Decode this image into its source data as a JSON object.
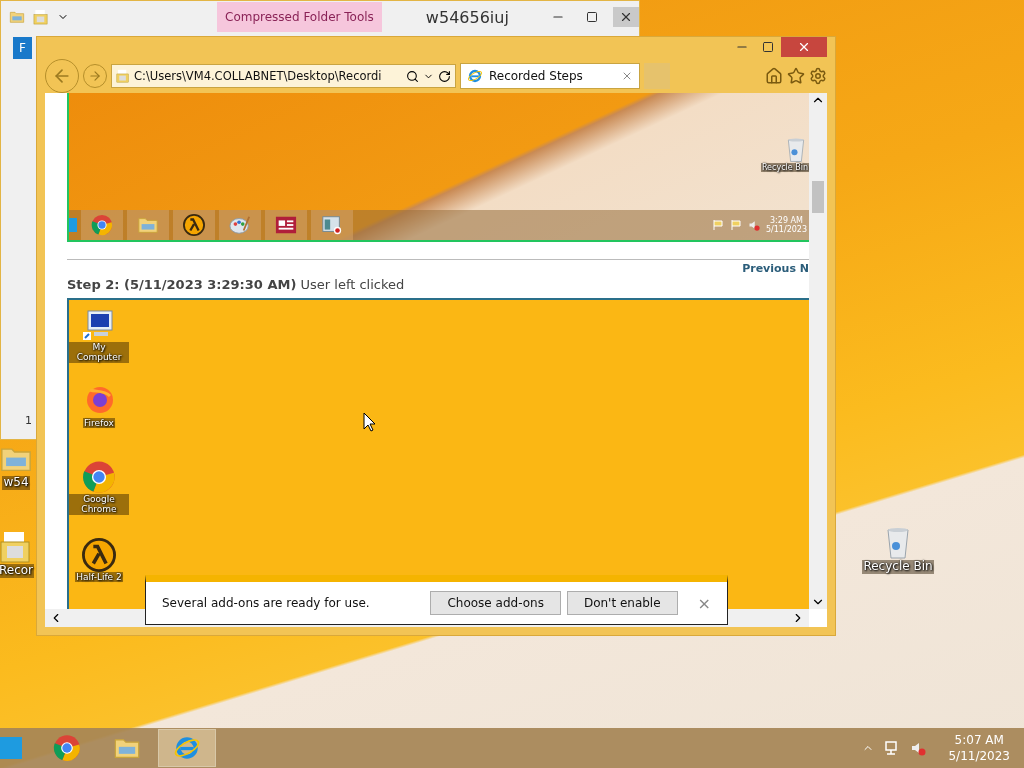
{
  "explorer_window": {
    "title": "w54656iuj",
    "contextual_tab": "Compressed Folder Tools",
    "ribbon_tab": "F",
    "status": "1"
  },
  "desktop_icons": [
    {
      "label": "w54",
      "kind": "folder"
    },
    {
      "label": "Recor",
      "kind": "document"
    },
    {
      "label": "Recycle Bin",
      "kind": "bin"
    }
  ],
  "browser": {
    "address": "C:\\Users\\VM4.COLLABNET\\Desktop\\Recordi",
    "tabs": [
      {
        "label": "Recorded Steps",
        "selected": true
      }
    ],
    "step_1_screenshot": {
      "desktop_icon": "Recycle Bin",
      "taskbar_apps": [
        {
          "kind": "chrome"
        },
        {
          "kind": "explorer"
        },
        {
          "kind": "halflife"
        },
        {
          "kind": "paint"
        },
        {
          "kind": "news"
        },
        {
          "kind": "recorder"
        }
      ],
      "time": "3:29 AM",
      "date": "5/11/2023"
    },
    "nav_link": "Previous N",
    "step_2": {
      "heading": "**Step 2: (5/11/2023 3:29:30 AM)** User left clicked",
      "desktop_icons": [
        {
          "label": "My Computer",
          "kind": "computer"
        },
        {
          "label": "Firefox",
          "kind": "firefox"
        },
        {
          "label": "Google Chrome",
          "kind": "chrome"
        },
        {
          "label": "Half-Life 2",
          "kind": "halflife"
        }
      ]
    },
    "notification": {
      "message": "Several add-ons are ready for use.",
      "buttons": [
        "Choose add-ons",
        "Don't enable"
      ],
      "close": "×"
    }
  },
  "taskbar": {
    "apps": [
      {
        "kind": "chrome",
        "selected": false
      },
      {
        "kind": "explorer",
        "selected": false
      },
      {
        "kind": "ie",
        "selected": true
      }
    ],
    "time": "5:07 AM",
    "date": "5/11/2023"
  }
}
